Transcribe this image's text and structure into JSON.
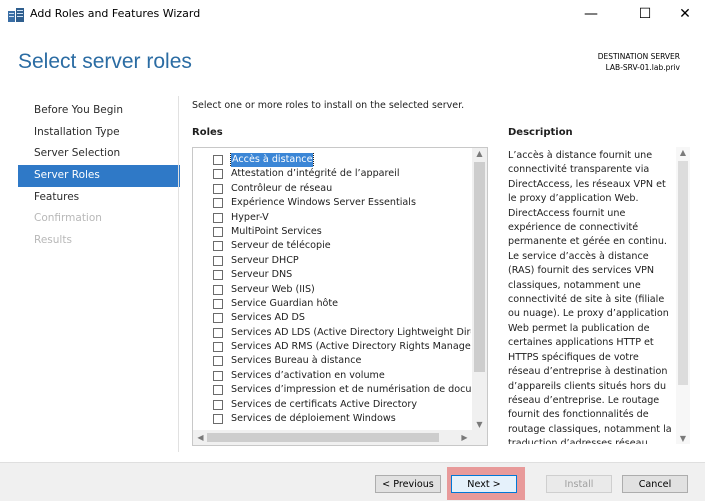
{
  "window": {
    "title": "Add Roles and Features Wizard",
    "minimize_glyph": "—",
    "maximize_glyph": "☐",
    "close_glyph": "✕"
  },
  "header": {
    "page_title": "Select server roles",
    "destination_label": "DESTINATION SERVER",
    "destination_server": "LAB-SRV-01.lab.priv"
  },
  "nav": {
    "items": [
      {
        "label": "Before You Begin",
        "state": "normal"
      },
      {
        "label": "Installation Type",
        "state": "normal"
      },
      {
        "label": "Server Selection",
        "state": "normal"
      },
      {
        "label": "Server Roles",
        "state": "active"
      },
      {
        "label": "Features",
        "state": "normal"
      },
      {
        "label": "Confirmation",
        "state": "disabled"
      },
      {
        "label": "Results",
        "state": "disabled"
      }
    ]
  },
  "main": {
    "instruction": "Select one or more roles to install on the selected server.",
    "roles_heading": "Roles",
    "description_heading": "Description",
    "roles": [
      {
        "label": "Accès à distance",
        "selected": true
      },
      {
        "label": "Attestation d’intégrité de l’appareil"
      },
      {
        "label": "Contrôleur de réseau"
      },
      {
        "label": "Expérience Windows Server Essentials"
      },
      {
        "label": "Hyper-V"
      },
      {
        "label": "MultiPoint Services"
      },
      {
        "label": "Serveur de télécopie"
      },
      {
        "label": "Serveur DHCP"
      },
      {
        "label": "Serveur DNS"
      },
      {
        "label": "Serveur Web (IIS)"
      },
      {
        "label": "Service Guardian hôte"
      },
      {
        "label": "Services AD DS"
      },
      {
        "label": "Services AD LDS (Active Directory Lightweight Dire"
      },
      {
        "label": "Services AD RMS (Active Directory Rights Manager"
      },
      {
        "label": "Services Bureau à distance"
      },
      {
        "label": "Services d’activation en volume"
      },
      {
        "label": "Services d’impression et de numérisation de docu"
      },
      {
        "label": "Services de certificats Active Directory"
      },
      {
        "label": "Services de déploiement Windows"
      }
    ],
    "description": "L’accès à distance fournit une connectivité transparente via DirectAccess, les réseaux VPN et le proxy d’application Web. DirectAccess fournit une expérience de connectivité permanente et gérée en continu. Le service d’accès à distance (RAS) fournit des services VPN classiques, notamment une connectivité de site à site (filiale ou nuage). Le proxy d’application Web permet la publication de certaines applications HTTP et HTTPS spécifiques de votre réseau d’entreprise à destination d’appareils clients situés hors du réseau d’entreprise. Le routage fournit des fonctionnalités de routage classiques, notamment la traduction d’adresses réseau"
  },
  "footer": {
    "previous_label": "< Previous",
    "next_label": "Next >",
    "install_label": "Install",
    "cancel_label": "Cancel"
  },
  "colors": {
    "accent": "#2f79c7",
    "title": "#2b6ca3",
    "highlight": "#e89a9a"
  }
}
